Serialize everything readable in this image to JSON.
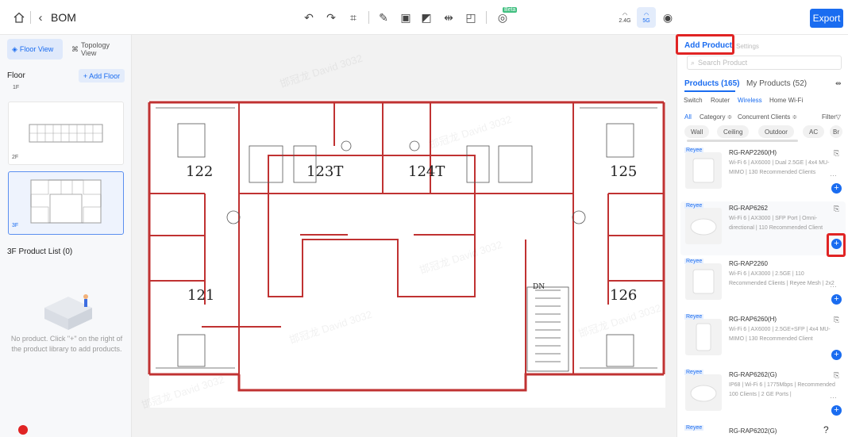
{
  "topbar": {
    "title": "BOM",
    "home_icon": "home-icon",
    "back_icon": "chevron-left-icon",
    "beta_label": "Beta",
    "band_24_label": "2.4G",
    "band_5_label": "5G",
    "export_label": "Export"
  },
  "left": {
    "tab_floor": "Floor View",
    "tab_topology": "Topology View",
    "floor_heading": "Floor",
    "add_floor": "+ Add Floor",
    "floors": [
      "1F",
      "2F",
      "3F"
    ],
    "product_list_heading": "3F Product List (0)",
    "empty_text": "No product. Click \"+\" on the right of the product library to add products."
  },
  "plan": {
    "rooms": [
      "122",
      "123T",
      "124T",
      "125",
      "121",
      "126"
    ],
    "stair_label": "DN"
  },
  "watermark": "邯冠龙 David 3032",
  "right": {
    "tab_add": "Add Product",
    "tab_settings": "Settings",
    "search_placeholder": "Search Product",
    "tab_products": "Products (165)",
    "tab_my_products": "My Products (52)",
    "categories": [
      "Switch",
      "Router",
      "Wireless",
      "Home Wi-Fi"
    ],
    "active_category": "Wireless",
    "filters": [
      "All",
      "Category ≑",
      "Concurrent Clients ≑",
      "Filter"
    ],
    "chips": [
      "Wall",
      "Ceiling",
      "Outdoor",
      "AC",
      "Br"
    ],
    "products": [
      {
        "brand": "Reyee",
        "name": "RG-RAP2260(H)",
        "desc": "Wi-Fi 6 | AX6000 | Dual 2.5GE | 4x4 MU-MIMO | 130 Recommended Clients"
      },
      {
        "brand": "Reyee",
        "name": "RG-RAP6262",
        "desc": "Wi-Fi 6 | AX3000 | SFP Port | Omni-directional | 110 Recommended Client"
      },
      {
        "brand": "Reyee",
        "name": "RG-RAP2260",
        "desc": "Wi-Fi 6 | AX3000 | 2.5GE | 110 Recommended Clients | Reyee Mesh | 2x2"
      },
      {
        "brand": "Reyee",
        "name": "RG-RAP6260(H)",
        "desc": "Wi-Fi 6 | AX6000 | 2.5GE+SFP | 4x4 MU-MIMO | 130 Recommended Client"
      },
      {
        "brand": "Reyee",
        "name": "RG-RAP6262(G)",
        "desc": "IP68 | Wi-Fi 6 | 1775Mbps | Recommended 100 Clients | 2 GE Ports |"
      },
      {
        "brand": "Reyee",
        "name": "RG-RAP6202(G)",
        "desc": ""
      }
    ],
    "help_glyph": "?"
  }
}
